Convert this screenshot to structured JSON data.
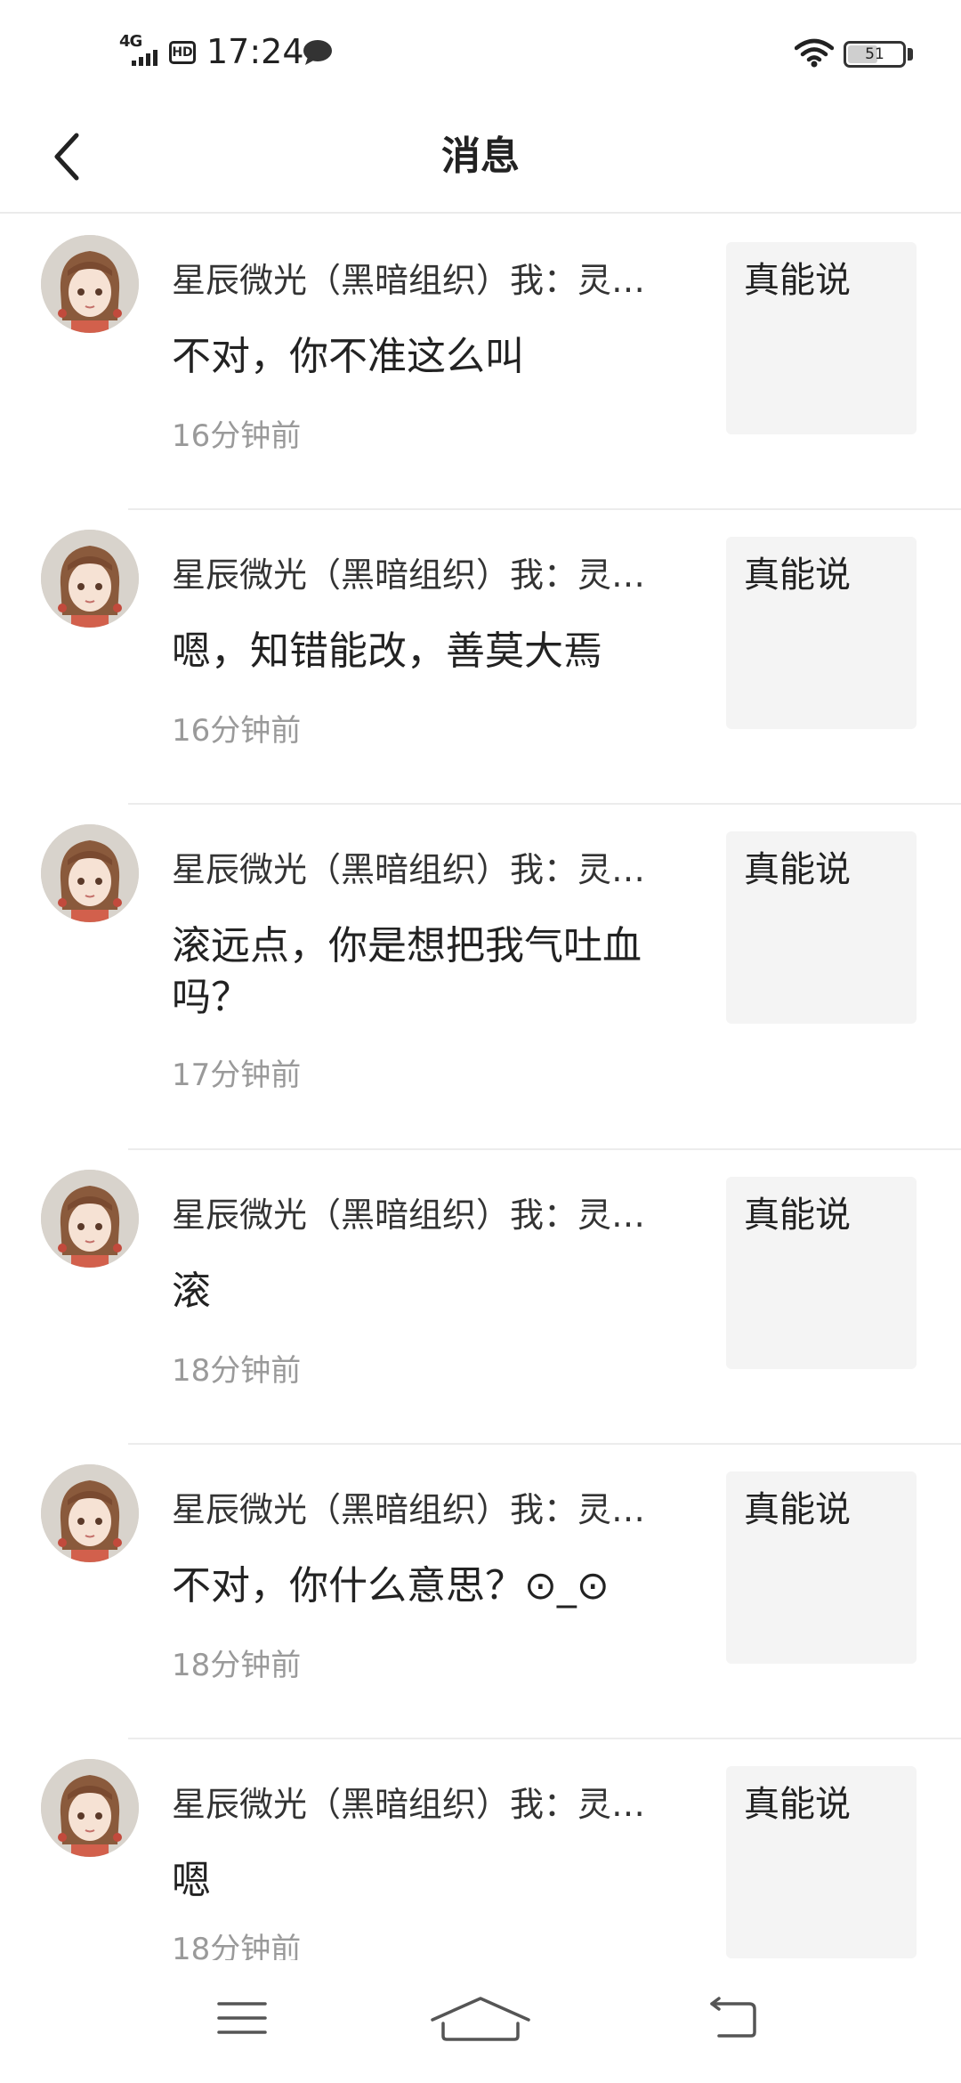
{
  "status_bar": {
    "network": "4G",
    "hd": "HD",
    "time": "17:24",
    "battery": "51",
    "battery_level": 0.51
  },
  "header": {
    "title": "消息"
  },
  "messages": [
    {
      "author": "星辰微光（黑暗组织）我：灵…",
      "text": "不对，你不准这么叫",
      "time": "16分钟前",
      "quote": "真能说"
    },
    {
      "author": "星辰微光（黑暗组织）我：灵…",
      "text": "嗯，知错能改，善莫大焉",
      "time": "16分钟前",
      "quote": "真能说"
    },
    {
      "author": "星辰微光（黑暗组织）我：灵…",
      "text": "滚远点，你是想把我气吐血吗？",
      "time": "17分钟前",
      "quote": "真能说"
    },
    {
      "author": "星辰微光（黑暗组织）我：灵…",
      "text": "滚",
      "time": "18分钟前",
      "quote": "真能说"
    },
    {
      "author": "星辰微光（黑暗组织）我：灵…",
      "text": "不对，你什么意思？⊙_⊙",
      "time": "18分钟前",
      "quote": "真能说"
    },
    {
      "author": "星辰微光（黑暗组织）我：灵…",
      "text": "嗯",
      "time": "18分钟前",
      "quote": "真能说"
    }
  ],
  "icons": {
    "back": "chevron-left-icon",
    "menu": "menu-icon",
    "home": "home-icon",
    "return": "return-icon"
  }
}
